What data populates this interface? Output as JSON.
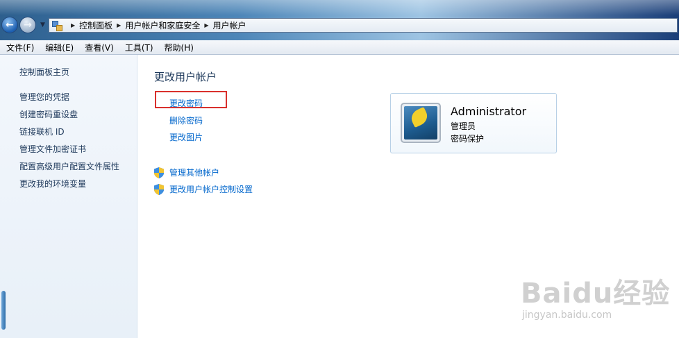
{
  "window": {
    "breadcrumb": [
      "控制面板",
      "用户帐户和家庭安全",
      "用户帐户"
    ]
  },
  "menu": [
    "文件(F)",
    "编辑(E)",
    "查看(V)",
    "工具(T)",
    "帮助(H)"
  ],
  "sidebar": {
    "home": "控制面板主页",
    "links": [
      "管理您的凭据",
      "创建密码重设盘",
      "链接联机 ID",
      "管理文件加密证书",
      "配置高级用户配置文件属性",
      "更改我的环境变量"
    ]
  },
  "main": {
    "title": "更改用户帐户",
    "links": [
      "更改密码",
      "删除密码",
      "更改图片"
    ],
    "shield_links": [
      "管理其他帐户",
      "更改用户帐户控制设置"
    ]
  },
  "user": {
    "name": "Administrator",
    "role": "管理员",
    "status": "密码保护"
  },
  "watermark": {
    "logo": "Baidu经验",
    "url": "jingyan.baidu.com"
  },
  "colors": {
    "link": "#0066cc",
    "highlight": "#d9302c",
    "text": "#1e395b"
  }
}
